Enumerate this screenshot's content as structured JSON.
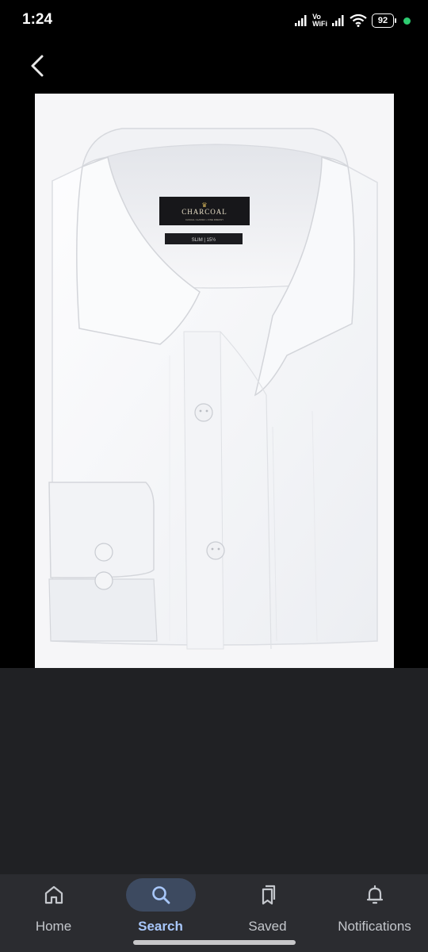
{
  "status_bar": {
    "time": "1:24",
    "network_label_top": "Vo",
    "network_label_bottom": "WiFi",
    "battery": "92",
    "icons": [
      "signal-icon",
      "signal-icon",
      "wifi-icon",
      "battery-icon",
      "notification-dot-icon"
    ]
  },
  "top_bar": {
    "back_icon": "chevron-left-icon"
  },
  "image": {
    "subject": "white dress shirt",
    "brand_label": "CHARCOAL",
    "brand_sublabel": "CASUAL CLASSIC • FINE DRESSY",
    "size_label": "SLIM | 15½"
  },
  "bottom_nav": {
    "items": [
      {
        "label": "Home",
        "icon": "home-icon",
        "active": false
      },
      {
        "label": "Search",
        "icon": "search-icon",
        "active": true
      },
      {
        "label": "Saved",
        "icon": "bookmarks-icon",
        "active": false
      },
      {
        "label": "Notifications",
        "icon": "bell-icon",
        "active": false
      }
    ]
  },
  "colors": {
    "background": "#000000",
    "panel": "#202124",
    "nav_background": "#2b2c30",
    "active_pill": "#3d4a60",
    "active_label": "#a8c7fa",
    "inactive_label": "#c4c7cc",
    "status_dot": "#2ecc71"
  }
}
